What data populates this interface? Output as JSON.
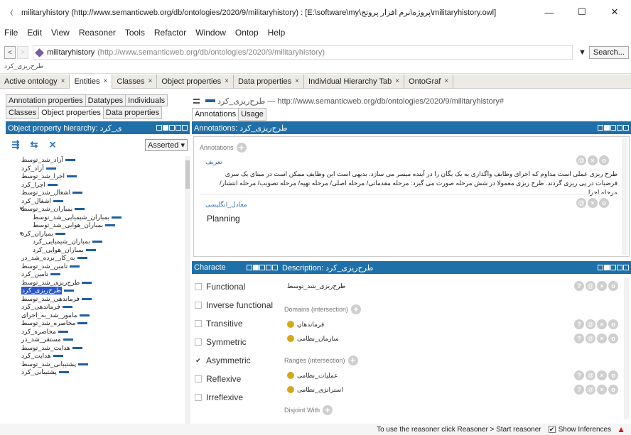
{
  "window": {
    "title": "militaryhistory (http://www.semanticweb.org/db/ontologies/2020/9/militaryhistory) : [E:\\software\\my\\پروژه\\نرم افزار پروتج\\militaryhistory.owl]",
    "minimize": "—",
    "maximize": "☐",
    "close": "✕"
  },
  "menu": [
    "File",
    "Edit",
    "View",
    "Reasoner",
    "Tools",
    "Refactor",
    "Window",
    "Ontop",
    "Help"
  ],
  "address": {
    "back": "<",
    "forward": ">",
    "name": "militaryhistory",
    "url": "(http://www.semanticweb.org/db/ontologies/2020/9/militaryhistory)",
    "search_label": "Search..."
  },
  "breadcrumb": "طرح‌ریزی_کرد",
  "tabs": [
    {
      "label": "Active ontology",
      "x": "×"
    },
    {
      "label": "Entities",
      "x": "×"
    },
    {
      "label": "Classes",
      "x": "×"
    },
    {
      "label": "Object properties",
      "x": "×"
    },
    {
      "label": "Data properties",
      "x": "×"
    },
    {
      "label": "Individual Hierarchy Tab",
      "x": "×"
    },
    {
      "label": "OntoGraf",
      "x": "×"
    }
  ],
  "left": {
    "tabs_row1": [
      "Annotation properties",
      "Datatypes",
      "Individuals"
    ],
    "tabs_row2": [
      "Classes",
      "Object properties",
      "Data properties"
    ],
    "panel_title": "Object property hierarchy: ی_کرد",
    "asserted": "Asserted ▾",
    "tree": [
      {
        "label": "آزاد_شد_توسط",
        "indent": 0
      },
      {
        "label": "آزاد_کرد",
        "indent": 0
      },
      {
        "label": "اجرا_شد_توسط",
        "indent": 0
      },
      {
        "label": "اجرا_کرد",
        "indent": 0
      },
      {
        "label": "اشغال_شد_توسط",
        "indent": 0
      },
      {
        "label": "اشغال_کرد",
        "indent": 0
      },
      {
        "label": "بمباران_شد_توسط",
        "indent": 0,
        "exp": "▼"
      },
      {
        "label": "بمباران_شیمیایی_شد_توسط",
        "indent": 1
      },
      {
        "label": "بمباران_هوایی_شد_توسط",
        "indent": 1
      },
      {
        "label": "بمباران_کرد",
        "indent": 0,
        "exp": "▼"
      },
      {
        "label": "بمباران_شیمیایی_کرد",
        "indent": 1
      },
      {
        "label": "بمباران_هوایی_کرد",
        "indent": 1
      },
      {
        "label": "به_کار_برده_شد_در",
        "indent": 0
      },
      {
        "label": "تامین_شد_توسط",
        "indent": 0
      },
      {
        "label": "تامین_کرد",
        "indent": 0
      },
      {
        "label": "طرح‌ریزی_شد_توسط",
        "indent": 0
      },
      {
        "label": "طرح‌ریزی_کرد",
        "indent": 0,
        "sel": true
      },
      {
        "label": "فرماندهی_شد_توسط",
        "indent": 0
      },
      {
        "label": "فرماندهی_کرد",
        "indent": 0
      },
      {
        "label": "مامور_شد_به_اجرای",
        "indent": 0
      },
      {
        "label": "محاصره_شد_توسط",
        "indent": 0
      },
      {
        "label": "محاصره_کرد",
        "indent": 0
      },
      {
        "label": "مستقر_شد_در",
        "indent": 0
      },
      {
        "label": "هدایت_شد_توسط",
        "indent": 0
      },
      {
        "label": "هدایت_کرد",
        "indent": 0
      },
      {
        "label": "پشتیبانی_شد_توسط",
        "indent": 0
      },
      {
        "label": "پشتیبانی_کرد",
        "indent": 0
      }
    ]
  },
  "right": {
    "header_label": "طرح‌ریزی_کرد",
    "header_url": "#http://www.semanticweb.org/db/ontologies/2020/9/militaryhistory — طرح‌ریزی_کرد",
    "tabs": [
      "Annotations",
      "Usage"
    ],
    "annotations_title": "Annotations: طرح‌ریزی_کرد",
    "annotations_label": "Annotations",
    "ann1_prop": "تعریف",
    "ann1_text": "طرح ریزی عملی است مداوم که اجرای وظایف واگذاری به یک یگان را در آینده میسر می سازد. بدیهی است این وظایف ممکن است در مبنای یک سری فرضیات در پی ریزی گردند. طرح ریزی معمولا در شش مرحله صورت می گیرد: مرحله مقدماتی/ مرحله اصلی/ مرحله تهیه/ مرحله تصویب/ مرحله انتشار/ مرحله اجرا",
    "ann2_prop": "معادل_انگلیسی",
    "ann2_text": "Planning",
    "char_title": "Characte",
    "characteristics": [
      {
        "label": "Functional",
        "checked": false
      },
      {
        "label": "Inverse functional",
        "checked": false
      },
      {
        "label": "Transitive",
        "checked": false
      },
      {
        "label": "Symmetric",
        "checked": false
      },
      {
        "label": "Asymmetric",
        "checked": true
      },
      {
        "label": "Reflexive",
        "checked": false
      },
      {
        "label": "Irreflexive",
        "checked": false
      }
    ],
    "desc_title": "Description: طرح‌ریزی_کرد",
    "inverse": "طرح‌ریزی_شد_توسط",
    "domains_label": "Domains (intersection)",
    "domains": [
      "فرماندهان",
      "سازمان_نظامی"
    ],
    "ranges_label": "Ranges (intersection)",
    "ranges": [
      "عملیات_نظامی",
      "استراتژی_نظامی"
    ],
    "disjoint_label": "Disjoint With"
  },
  "status": {
    "text": "To use the reasoner click Reasoner > Start reasoner",
    "show_inferences": "Show Inferences",
    "checkmark": "✔",
    "warn": "▲"
  }
}
